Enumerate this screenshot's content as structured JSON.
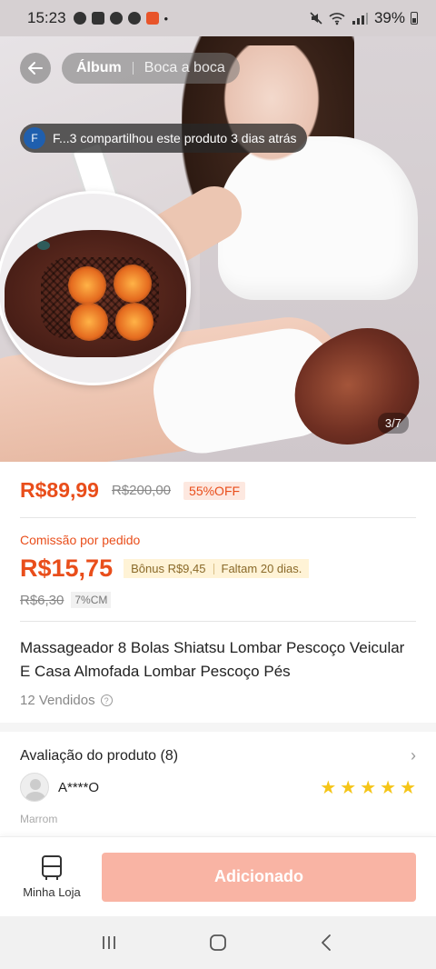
{
  "status_bar": {
    "time": "15:23",
    "battery": "39%"
  },
  "hero": {
    "back_icon": "arrow-left-icon",
    "tabs": [
      {
        "label": "Álbum",
        "active": true
      },
      {
        "label": "Boca a boca",
        "active": false
      }
    ],
    "share_avatar_letter": "F",
    "share_text": "F...3 compartilhou este produto 3 dias atrás",
    "page_indicator": "3/7"
  },
  "product": {
    "price": "R$89,99",
    "old_price": "R$200,00",
    "discount_badge": "55%OFF",
    "commission_label": "Comissão por pedido",
    "commission_value": "R$15,75",
    "bonus_text": "Bônus R$9,45",
    "bonus_remaining": "Faltam 20 dias.",
    "commission_old": "R$6,30",
    "commission_rate": "7%CM",
    "title": "Massageador 8 Bolas Shiatsu Lombar Pescoço Veicular E Casa Almofada Lombar Pescoço Pés",
    "sold": "12 Vendidos",
    "help_glyph": "?"
  },
  "reviews": {
    "header": "Avaliação do produto (8)",
    "chevron": "›",
    "reviewer": "A****O",
    "stars": 5,
    "star_glyph": "★",
    "variant": "Marrom"
  },
  "action_bar": {
    "store_label": "Minha Loja",
    "add_button": "Adicionado"
  },
  "colors": {
    "accent": "#e94e1b",
    "add_button_bg": "#f9b4a4",
    "star": "#f5c518",
    "bonus_bg": "#fff3d6"
  }
}
